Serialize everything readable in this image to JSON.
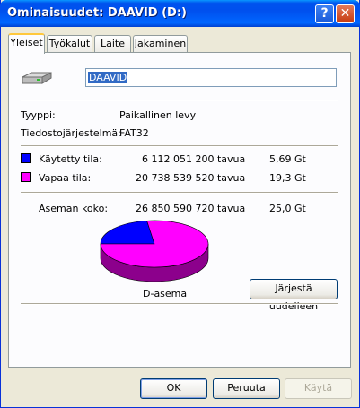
{
  "window": {
    "title": "Ominaisuudet: DAAVID (D:)",
    "help_glyph": "?",
    "close_glyph": "✕"
  },
  "tabs": [
    {
      "label": "Yleiset"
    },
    {
      "label": "Työkalut"
    },
    {
      "label": "Laite"
    },
    {
      "label": "Jakaminen"
    }
  ],
  "general": {
    "drive_icon": "drive-icon",
    "volume_name": "DAAVID",
    "type_label": "Tyyppi:",
    "type_value": "Paikallinen levy",
    "fs_label": "Tiedostojärjestelmä:",
    "fs_value": "FAT32",
    "used": {
      "label": "Käytetty tila:",
      "bytes": "6 112 051 200 tavua",
      "size": "5,69 Gt",
      "color": "#0000ff"
    },
    "free": {
      "label": "Vapaa tila:",
      "bytes": "20 738 539 520 tavua",
      "size": "19,3 Gt",
      "color": "#ff00ff"
    },
    "capacity": {
      "label": "Aseman koko:",
      "bytes": "26 850 590 720 tavua",
      "size": "25,0 Gt"
    },
    "drive_label": "D-asema",
    "defrag_button": "Järjestä uudelleen"
  },
  "chart_data": {
    "type": "pie",
    "categories": [
      "Käytetty tila",
      "Vapaa tila"
    ],
    "values": [
      6112051200,
      20738539520
    ],
    "colors": [
      "#0000ff",
      "#ff00ff"
    ],
    "title": "D-asema"
  },
  "buttons": {
    "ok": "OK",
    "cancel": "Peruuta",
    "apply": "Käytä"
  }
}
